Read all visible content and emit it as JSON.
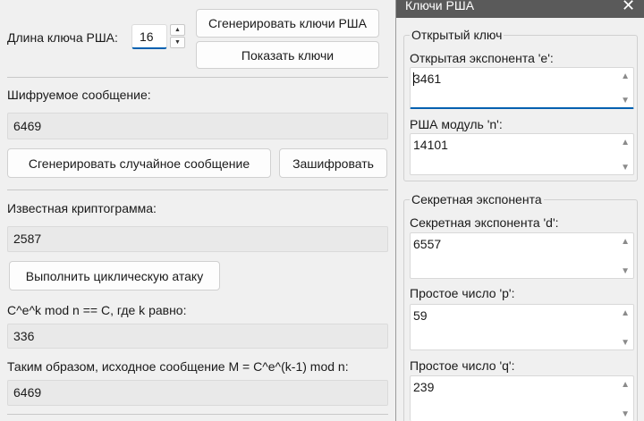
{
  "main": {
    "key_length_label": "Длина ключа РША:",
    "key_length_value": "16",
    "generate_keys_button": "Сгенерировать ключи РША",
    "show_keys_button": "Показать ключи",
    "message_label": "Шифруемое сообщение:",
    "message_value": "6469",
    "random_message_button": "Сгенерировать случайное сообщение",
    "encrypt_button": "Зашифровать",
    "ciphertext_label": "Известная криптограмма:",
    "ciphertext_value": "2587",
    "cyclic_attack_button": "Выполнить циклическую атаку",
    "k_label": "C^e^k mod n == C, где k равно:",
    "k_value": "336",
    "result_label": "Таким образом, исходное сообщение M = C^e^(k-1) mod n:",
    "result_value": "6469"
  },
  "dialog": {
    "title": "Ключи РША",
    "close_glyph": "✕",
    "public_group_title": "Открытый ключ",
    "e_label": "Открытая экспонента 'e':",
    "e_value": "3461",
    "n_label": "РША модуль 'n':",
    "n_value": "14101",
    "secret_group_title": "Секретная экспонента",
    "d_label": "Секретная экспонента 'd':",
    "d_value": "6557",
    "p_label": "Простое число 'p':",
    "p_value": "59",
    "q_label": "Простое число 'q':",
    "q_value": "239",
    "scroll_up_glyph": "▲",
    "scroll_down_glyph": "▼"
  },
  "colors": {
    "focus_accent": "#0060b0",
    "titlebar": "#5a5a5a"
  }
}
